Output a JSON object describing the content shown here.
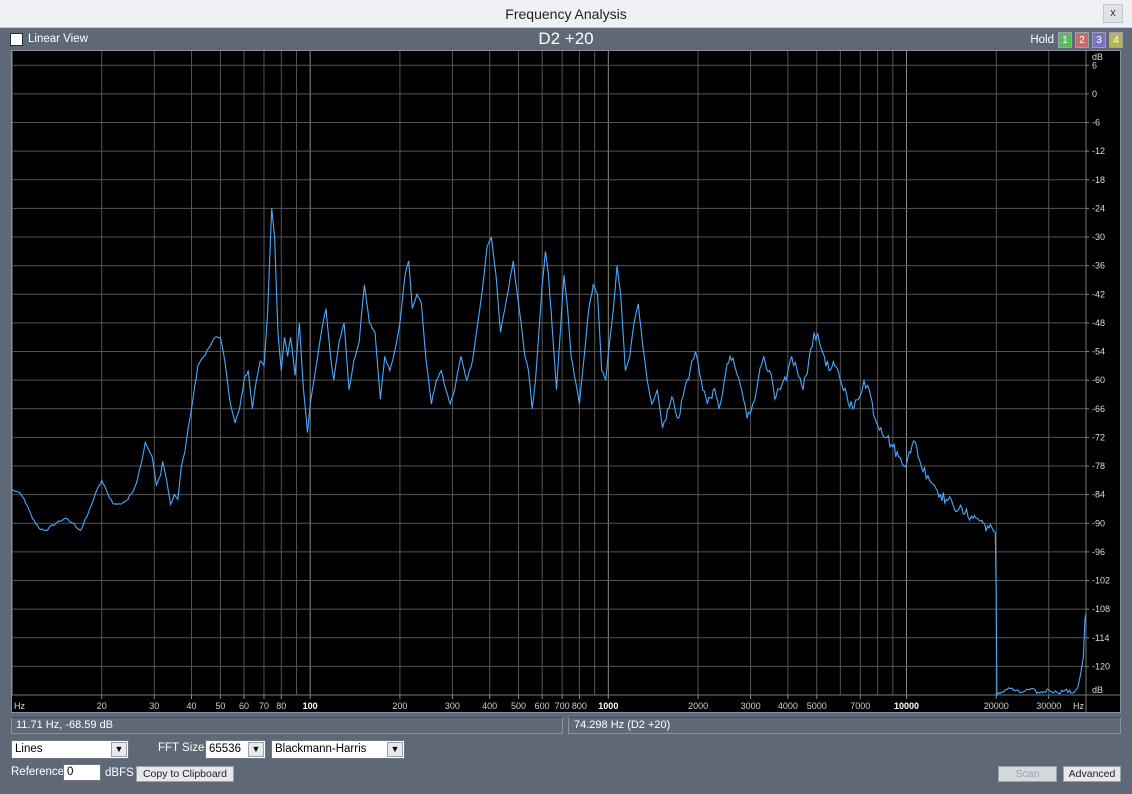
{
  "window": {
    "title": "Frequency Analysis",
    "close_glyph": "x"
  },
  "toolbar": {
    "linear_view_label": "Linear View",
    "linear_view_checked": false,
    "plot_title": "D2 +20",
    "hold_label": "Hold",
    "hold_buttons": [
      {
        "label": "1",
        "color": "#5cb860"
      },
      {
        "label": "2",
        "color": "#c86a6a"
      },
      {
        "label": "3",
        "color": "#7a70c8"
      },
      {
        "label": "4",
        "color": "#b8b45a"
      }
    ]
  },
  "status": {
    "cursor_readout": "11.71 Hz, -68.59 dB",
    "peak_readout": "74.298 Hz (D2 +20)"
  },
  "controls": {
    "draw_mode": "Lines",
    "fft_size_label": "FFT Size",
    "fft_size": "65536",
    "window_function": "Blackmann-Harris",
    "reference_label": "Reference",
    "reference_value": "0",
    "reference_unit": "dBFS",
    "copy_button": "Copy to Clipboard",
    "scan_button": "Scan",
    "advanced_button": "Advanced"
  },
  "chart_data": {
    "type": "line",
    "x_scale": "log",
    "xlim": [
      10,
      40000
    ],
    "ylim": [
      -126,
      9
    ],
    "x_unit_label": "Hz",
    "y_unit_label": "dB",
    "x_tick_labels": [
      {
        "value": 20,
        "label": "20"
      },
      {
        "value": 30,
        "label": "30"
      },
      {
        "value": 40,
        "label": "40"
      },
      {
        "value": 50,
        "label": "50"
      },
      {
        "value": 60,
        "label": "60"
      },
      {
        "value": 70,
        "label": "70"
      },
      {
        "value": 80,
        "label": "80"
      },
      {
        "value": 100,
        "label": "100"
      },
      {
        "value": 200,
        "label": "200"
      },
      {
        "value": 300,
        "label": "300"
      },
      {
        "value": 400,
        "label": "400"
      },
      {
        "value": 500,
        "label": "500"
      },
      {
        "value": 600,
        "label": "600"
      },
      {
        "value": 700,
        "label": "700"
      },
      {
        "value": 800,
        "label": "800"
      },
      {
        "value": 1000,
        "label": "1000"
      },
      {
        "value": 2000,
        "label": "2000"
      },
      {
        "value": 3000,
        "label": "3000"
      },
      {
        "value": 4000,
        "label": "4000"
      },
      {
        "value": 5000,
        "label": "5000"
      },
      {
        "value": 7000,
        "label": "7000"
      },
      {
        "value": 10000,
        "label": "10000"
      },
      {
        "value": 20000,
        "label": "20000"
      },
      {
        "value": 30000,
        "label": "30000"
      }
    ],
    "y_ticks": [
      6,
      0,
      -6,
      -12,
      -18,
      -24,
      -30,
      -36,
      -42,
      -48,
      -54,
      -60,
      -66,
      -72,
      -78,
      -84,
      -90,
      -96,
      -102,
      -108,
      -114,
      -120
    ],
    "grid": true,
    "series": [
      {
        "color": "#4aa8ff",
        "points": [
          [
            10,
            -83
          ],
          [
            10.5,
            -83.5
          ],
          [
            11,
            -85
          ],
          [
            11.71,
            -89
          ],
          [
            12.3,
            -91
          ],
          [
            13,
            -91.5
          ],
          [
            14,
            -90
          ],
          [
            15,
            -89
          ],
          [
            16,
            -90
          ],
          [
            17,
            -91.5
          ],
          [
            18,
            -88
          ],
          [
            19,
            -84
          ],
          [
            20,
            -81
          ],
          [
            21,
            -84
          ],
          [
            22,
            -86
          ],
          [
            23,
            -86
          ],
          [
            24.5,
            -85
          ],
          [
            26,
            -82
          ],
          [
            27,
            -78
          ],
          [
            28,
            -73
          ],
          [
            29.5,
            -76
          ],
          [
            30.5,
            -82
          ],
          [
            31.5,
            -80
          ],
          [
            32,
            -77
          ],
          [
            33,
            -81
          ],
          [
            34,
            -86
          ],
          [
            35,
            -84
          ],
          [
            36,
            -85
          ],
          [
            37,
            -78
          ],
          [
            38,
            -75
          ],
          [
            39,
            -70
          ],
          [
            40,
            -66
          ],
          [
            42,
            -57
          ],
          [
            44,
            -55
          ],
          [
            46,
            -53
          ],
          [
            48,
            -51
          ],
          [
            50,
            -51
          ],
          [
            52,
            -57
          ],
          [
            54,
            -65
          ],
          [
            56,
            -69
          ],
          [
            58,
            -66
          ],
          [
            60,
            -60
          ],
          [
            62,
            -58
          ],
          [
            64,
            -66
          ],
          [
            66,
            -60
          ],
          [
            68,
            -56
          ],
          [
            70,
            -57
          ],
          [
            72,
            -46
          ],
          [
            74.3,
            -24
          ],
          [
            76,
            -30
          ],
          [
            78,
            -50
          ],
          [
            80,
            -58
          ],
          [
            82,
            -51
          ],
          [
            84,
            -55
          ],
          [
            86,
            -51
          ],
          [
            89,
            -59
          ],
          [
            92,
            -48
          ],
          [
            95,
            -62
          ],
          [
            98,
            -71
          ],
          [
            100,
            -65
          ],
          [
            103,
            -60
          ],
          [
            106,
            -55
          ],
          [
            109,
            -50
          ],
          [
            113,
            -45
          ],
          [
            117,
            -55
          ],
          [
            120,
            -60
          ],
          [
            125,
            -52
          ],
          [
            130,
            -48
          ],
          [
            135,
            -62
          ],
          [
            140,
            -56
          ],
          [
            146,
            -52
          ],
          [
            152,
            -40
          ],
          [
            158,
            -48
          ],
          [
            165,
            -50
          ],
          [
            172,
            -64
          ],
          [
            178,
            -55
          ],
          [
            185,
            -58
          ],
          [
            192,
            -54
          ],
          [
            200,
            -48
          ],
          [
            208,
            -38
          ],
          [
            214,
            -35
          ],
          [
            220,
            -45
          ],
          [
            228,
            -42
          ],
          [
            236,
            -44
          ],
          [
            245,
            -56
          ],
          [
            255,
            -65
          ],
          [
            265,
            -60
          ],
          [
            275,
            -58
          ],
          [
            285,
            -62
          ],
          [
            295,
            -65
          ],
          [
            305,
            -62
          ],
          [
            320,
            -55
          ],
          [
            335,
            -60
          ],
          [
            350,
            -56
          ],
          [
            365,
            -48
          ],
          [
            380,
            -40
          ],
          [
            392,
            -32
          ],
          [
            405,
            -30
          ],
          [
            420,
            -38
          ],
          [
            435,
            -50
          ],
          [
            450,
            -45
          ],
          [
            465,
            -40
          ],
          [
            480,
            -35
          ],
          [
            495,
            -42
          ],
          [
            510,
            -48
          ],
          [
            525,
            -55
          ],
          [
            540,
            -58
          ],
          [
            555,
            -66
          ],
          [
            570,
            -60
          ],
          [
            585,
            -50
          ],
          [
            600,
            -40
          ],
          [
            615,
            -33
          ],
          [
            630,
            -38
          ],
          [
            650,
            -50
          ],
          [
            670,
            -62
          ],
          [
            690,
            -50
          ],
          [
            710,
            -38
          ],
          [
            730,
            -45
          ],
          [
            750,
            -55
          ],
          [
            775,
            -60
          ],
          [
            800,
            -65
          ],
          [
            830,
            -55
          ],
          [
            860,
            -45
          ],
          [
            890,
            -40
          ],
          [
            920,
            -42
          ],
          [
            950,
            -58
          ],
          [
            980,
            -60
          ],
          [
            1010,
            -52
          ],
          [
            1040,
            -45
          ],
          [
            1070,
            -36
          ],
          [
            1100,
            -42
          ],
          [
            1140,
            -58
          ],
          [
            1180,
            -55
          ],
          [
            1220,
            -48
          ],
          [
            1260,
            -44
          ],
          [
            1300,
            -52
          ],
          [
            1350,
            -60
          ],
          [
            1400,
            -65
          ],
          [
            1460,
            -62
          ],
          [
            1520,
            -70
          ],
          [
            1580,
            -66
          ],
          [
            1650,
            -64
          ],
          [
            1720,
            -68
          ],
          [
            1800,
            -62
          ],
          [
            1880,
            -58
          ],
          [
            1960,
            -54
          ],
          [
            2050,
            -60
          ],
          [
            2150,
            -65
          ],
          [
            2250,
            -62
          ],
          [
            2350,
            -66
          ],
          [
            2450,
            -60
          ],
          [
            2560,
            -55
          ],
          [
            2680,
            -58
          ],
          [
            2800,
            -62
          ],
          [
            2920,
            -68
          ],
          [
            3050,
            -65
          ],
          [
            3180,
            -60
          ],
          [
            3320,
            -55
          ],
          [
            3470,
            -58
          ],
          [
            3620,
            -64
          ],
          [
            3780,
            -62
          ],
          [
            3950,
            -60
          ],
          [
            4120,
            -55
          ],
          [
            4300,
            -58
          ],
          [
            4500,
            -62
          ],
          [
            4700,
            -56
          ],
          [
            4900,
            -50
          ],
          [
            5100,
            -52
          ],
          [
            5300,
            -55
          ],
          [
            5500,
            -58
          ],
          [
            5750,
            -57
          ],
          [
            6000,
            -60
          ],
          [
            6300,
            -63
          ],
          [
            6600,
            -66
          ],
          [
            6900,
            -64
          ],
          [
            7200,
            -60
          ],
          [
            7500,
            -62
          ],
          [
            7850,
            -68
          ],
          [
            8200,
            -70
          ],
          [
            8600,
            -72
          ],
          [
            9000,
            -74
          ],
          [
            9400,
            -76
          ],
          [
            9800,
            -78
          ],
          [
            10200,
            -75
          ],
          [
            10700,
            -73
          ],
          [
            11200,
            -78
          ],
          [
            11800,
            -80
          ],
          [
            12400,
            -82
          ],
          [
            13000,
            -84
          ],
          [
            13600,
            -85
          ],
          [
            14300,
            -86
          ],
          [
            15000,
            -87
          ],
          [
            15700,
            -88
          ],
          [
            16500,
            -88.5
          ],
          [
            17300,
            -89
          ],
          [
            18100,
            -90
          ],
          [
            18900,
            -91
          ],
          [
            19500,
            -91.5
          ],
          [
            19850,
            -92
          ],
          [
            20000,
            -104
          ],
          [
            20100,
            -126
          ],
          [
            22000,
            -124.5
          ],
          [
            24000,
            -125.5
          ],
          [
            26000,
            -124.8
          ],
          [
            28000,
            -125.6
          ],
          [
            30000,
            -124.9
          ],
          [
            32000,
            -125.5
          ],
          [
            34000,
            -125
          ],
          [
            36000,
            -125.6
          ],
          [
            37500,
            -124.5
          ],
          [
            38500,
            -121
          ],
          [
            39200,
            -118
          ],
          [
            39700,
            -110
          ],
          [
            40000,
            -109
          ]
        ]
      }
    ]
  }
}
